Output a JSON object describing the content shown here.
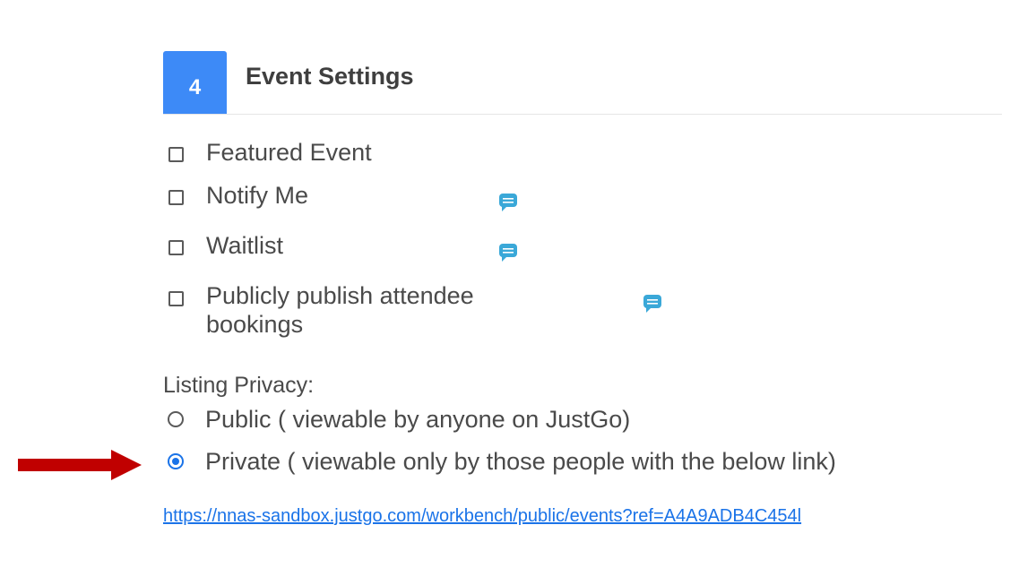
{
  "section": {
    "step_number": "4",
    "title": "Event Settings"
  },
  "checkboxes": [
    {
      "label": "Featured Event",
      "checked": false,
      "has_info": false
    },
    {
      "label": "Notify Me",
      "checked": false,
      "has_info": true
    },
    {
      "label": "Waitlist",
      "checked": false,
      "has_info": true
    },
    {
      "label_line1": "Publicly publish attendee",
      "label_line2": "bookings",
      "checked": false,
      "has_info": true
    }
  ],
  "privacy": {
    "label": "Listing Privacy:",
    "options": [
      {
        "label": "Public ( viewable by anyone on JustGo)",
        "selected": false
      },
      {
        "label": "Private ( viewable only by those people with the below link)",
        "selected": true
      }
    ],
    "link": "https://nnas-sandbox.justgo.com/workbench/public/events?ref=A4A9ADB4C454l"
  },
  "icons": {
    "info": "chat-bubble-icon",
    "annotation": "red-arrow-icon"
  },
  "colors": {
    "accent": "#3d8af7",
    "link": "#1a73e8",
    "info_icon": "#3aa8d8",
    "annotation_arrow": "#c00000"
  }
}
